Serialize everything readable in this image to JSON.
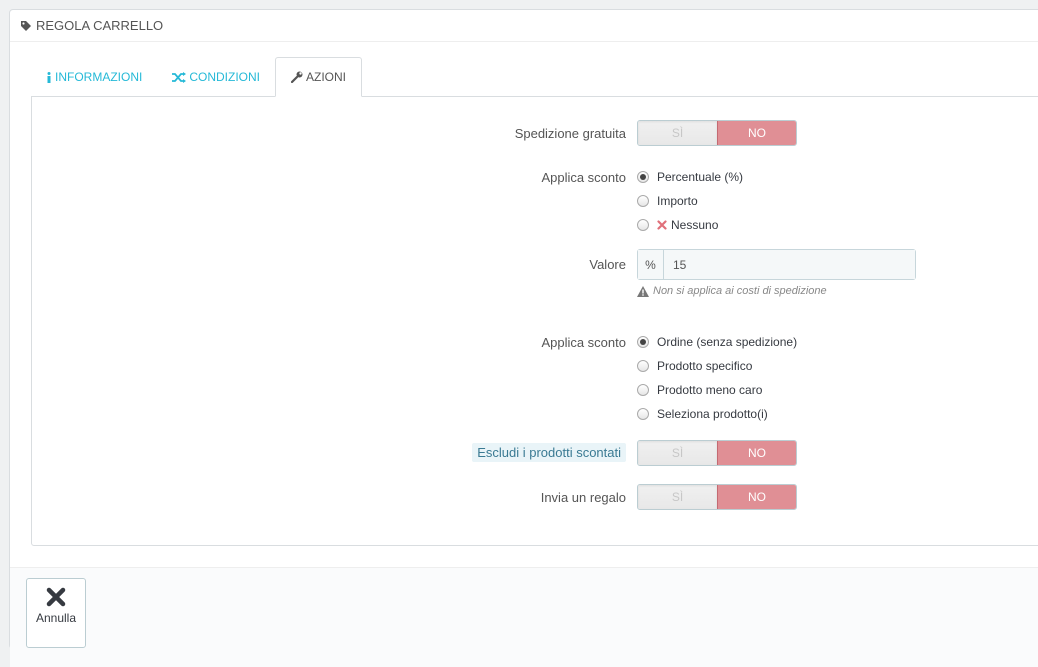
{
  "panel": {
    "title": "REGOLA CARRELLO"
  },
  "tabs": [
    {
      "label": "INFORMAZIONI",
      "icon": "info-icon"
    },
    {
      "label": "CONDIZIONI",
      "icon": "shuffle-icon"
    },
    {
      "label": "AZIONI",
      "icon": "wrench-icon"
    }
  ],
  "form": {
    "free_shipping": {
      "label": "Spedizione gratuita",
      "yes": "SÌ",
      "no": "NO"
    },
    "apply_discount": {
      "label": "Applica sconto",
      "options": [
        "Percentuale (%)",
        "Importo",
        "Nessuno"
      ]
    },
    "value": {
      "label": "Valore",
      "addon": "%",
      "value": "15",
      "help": "Non si applica ai costi di spedizione"
    },
    "apply_discount_to": {
      "label": "Applica sconto",
      "options": [
        "Ordine (senza spedizione)",
        "Prodotto specifico",
        "Prodotto meno caro",
        "Seleziona prodotto(i)"
      ]
    },
    "exclude_discounted": {
      "label": "Escludi i prodotti scontati",
      "yes": "SÌ",
      "no": "NO"
    },
    "send_gift": {
      "label": "Invia un regalo",
      "yes": "SÌ",
      "no": "NO"
    }
  },
  "footer": {
    "cancel_label": "Annulla"
  },
  "colors": {
    "accent": "#25b9d7",
    "switch_no": "#e08f95",
    "help_label_bg": "#e9f4f8"
  }
}
